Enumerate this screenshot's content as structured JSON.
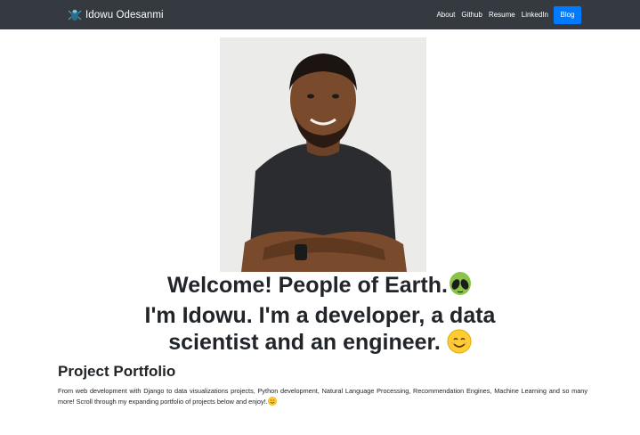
{
  "navbar": {
    "brand_name": "Idowu Odesanmi",
    "brand_logo_icon": "spider-logo-icon",
    "links": [
      {
        "label": "About"
      },
      {
        "label": "Github"
      },
      {
        "label": "Resume"
      },
      {
        "label": "LinkedIn"
      }
    ],
    "blog_button_label": "Blog",
    "colors": {
      "background": "#343a40",
      "accent": "#007bff"
    }
  },
  "hero": {
    "photo_icon": "profile-photo",
    "headline_line1": "Welcome! People of Earth.",
    "headline_line1_emoji": "alien-icon",
    "headline_line2": "I'm Idowu. I'm a developer, a data",
    "headline_line3": "scientist and an engineer.",
    "headline_line3_emoji": "smiling-face-icon"
  },
  "portfolio": {
    "title": "Project Portfolio",
    "description": "From web development with Django to data visualizations projects, Python development, Natural Language Processing, Recommendation Engines, Machine Learning and so many more! Scroll through my expanding portfolio of projects below and enjoy!.",
    "description_emoji": "smiling-face-icon"
  }
}
